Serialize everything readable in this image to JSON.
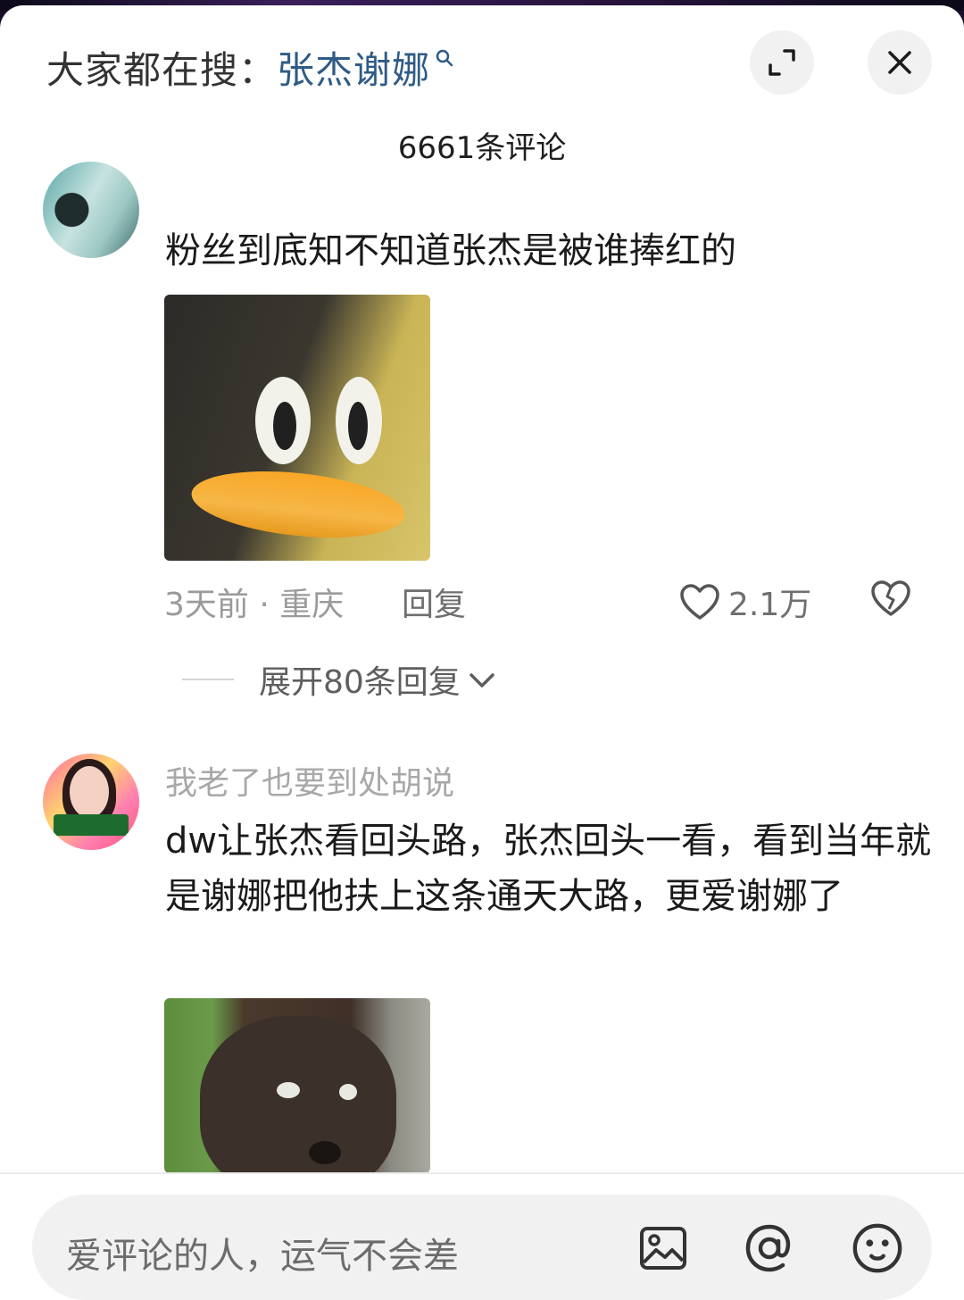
{
  "search": {
    "prefix": "大家都在搜：",
    "term": "张杰谢娜"
  },
  "comments_count": "6661条评论",
  "comments": [
    {
      "text": "粉丝到底知不知道张杰是被谁捧红的",
      "time_location": "3天前 · 重庆",
      "reply_label": "回复",
      "likes": "2.1万",
      "expand_replies": "展开80条回复"
    },
    {
      "username": "我老了也要到处胡说",
      "text": "dw让张杰看回头路，张杰回头一看，看到当年就是谢娜把他扶上这条通天大路，更爱谢娜了"
    }
  ],
  "input": {
    "placeholder": "爱评论的人，运气不会差"
  },
  "icons": {
    "expand": "expand-icon",
    "close": "close-icon",
    "heart": "heart-icon",
    "broken_heart": "broken-heart-icon",
    "chevron": "chevron-down-icon",
    "image": "image-icon",
    "at": "at-icon",
    "emoji": "emoji-icon"
  },
  "colors": {
    "search_term": "#2f5b86",
    "muted_text": "#9a9a9a"
  }
}
